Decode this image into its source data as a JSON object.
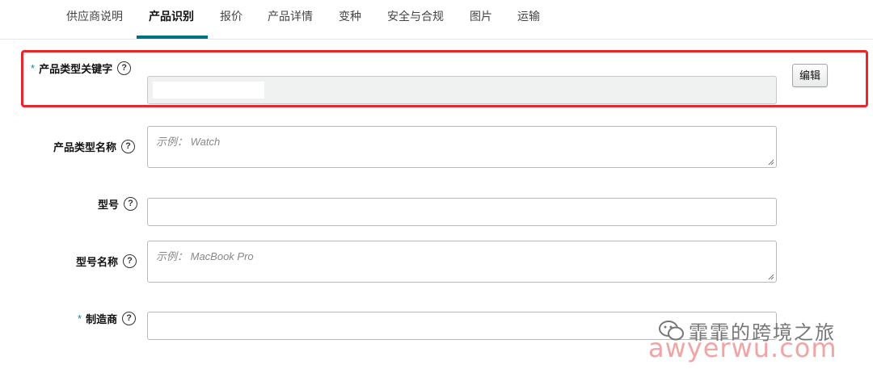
{
  "tabs": [
    {
      "label": "供应商说明",
      "active": false
    },
    {
      "label": "产品识别",
      "active": true
    },
    {
      "label": "报价",
      "active": false
    },
    {
      "label": "产品详情",
      "active": false
    },
    {
      "label": "变种",
      "active": false
    },
    {
      "label": "安全与合规",
      "active": false
    },
    {
      "label": "图片",
      "active": false
    },
    {
      "label": "运输",
      "active": false
    }
  ],
  "accent_color": "#007185",
  "highlight_color": "#e8262b",
  "form": {
    "product_type_keyword": {
      "required_mark": "*",
      "label": "产品类型关键字",
      "help_icon": "question-circle-icon",
      "edit_button": "编辑",
      "value": ""
    },
    "product_type_name": {
      "label": "产品类型名称",
      "placeholder": "示例： Watch"
    },
    "model_number": {
      "label": "型号",
      "value": ""
    },
    "model_name": {
      "label": "型号名称",
      "placeholder": "示例： MacBook Pro"
    },
    "manufacturer": {
      "required_mark": "*",
      "label": "制造商",
      "value": ""
    }
  },
  "help_glyph": "?",
  "watermark": {
    "text": "霏霏的跨境之旅",
    "url": "awyerwu.com",
    "icon": "wechat-icon"
  }
}
